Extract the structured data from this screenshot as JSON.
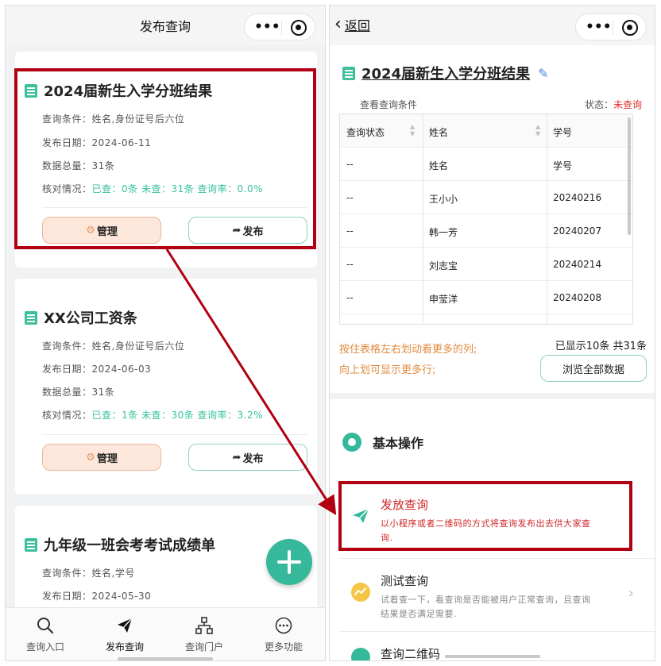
{
  "left": {
    "title": "发布查询",
    "cards": [
      {
        "title": "2024届新生入学分班结果",
        "condition": "查询条件：姓名,身份证号后六位",
        "date": "发布日期：2024-06-11",
        "total": "数据总量：31条",
        "check_label": "核对情况：",
        "check_value": "已查：0条 未查：31条 查询率：0.0%",
        "manage": "管理",
        "publish": "发布"
      },
      {
        "title": "XX公司工资条",
        "condition": "查询条件：姓名,身份证号后六位",
        "date": "发布日期：2024-06-03",
        "total": "数据总量：31条",
        "check_label": "核对情况：",
        "check_value": "已查：1条 未查：30条 查询率：3.2%",
        "manage": "管理",
        "publish": "发布"
      },
      {
        "title": "九年级一班会考考试成绩单",
        "condition": "查询条件：姓名,学号",
        "date": "发布日期：2024-05-30"
      }
    ],
    "tabs": [
      {
        "label": "查询入口",
        "icon": "search-icon"
      },
      {
        "label": "发布查询",
        "icon": "paper-plane-icon"
      },
      {
        "label": "查询门户",
        "icon": "portal-icon"
      },
      {
        "label": "更多功能",
        "icon": "more-icon"
      }
    ],
    "active_tab": 1
  },
  "right": {
    "back": "返回",
    "title": "2024届新生入学分班结果",
    "view_cond": "查看查询条件",
    "status_label": "状态：",
    "status_value": "未查询",
    "table": {
      "headers": [
        "查询状态",
        "姓名",
        "学号"
      ],
      "rows": [
        [
          "--",
          "姓名",
          "学号"
        ],
        [
          "--",
          "王小小",
          "20240216"
        ],
        [
          "--",
          "韩一芳",
          "20240207"
        ],
        [
          "--",
          "刘志宝",
          "20240214"
        ],
        [
          "--",
          "申莹洋",
          "20240208"
        ]
      ]
    },
    "hint1": "按住表格左右划动看更多的列;",
    "hint2": "向上划可显示更多行;",
    "shown": "已显示10条 共31条",
    "browse": "浏览全部数据",
    "section": "基本操作",
    "ops": [
      {
        "title": "发放查询",
        "desc": "以小程序或者二维码的方式将查询发布出去供大家查询.",
        "icon": "paper-plane-icon"
      },
      {
        "title": "测试查询",
        "desc": "试着查一下，看查询是否能被用户正常查询，且查询结果是否满足需要.",
        "icon": "test-icon"
      },
      {
        "title": "查询二维码",
        "icon": "qrcode-icon"
      }
    ]
  },
  "colors": {
    "accent": "#36b99a",
    "highlight": "#b00012",
    "alert": "#e0302c",
    "hint": "#e08a3c"
  }
}
